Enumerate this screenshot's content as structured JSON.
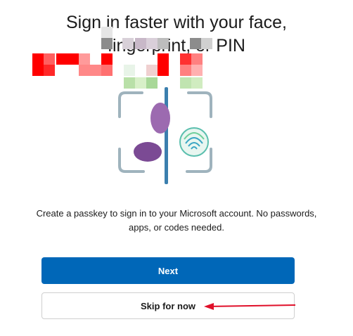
{
  "header": {
    "title_line1": "Sign in faster with your face,",
    "title_line2": "fingerprint, or PIN"
  },
  "main": {
    "description": "Create a passkey to sign in to your Microsoft account. No passwords, apps, or codes needed.",
    "illustration_icon": "passkey-face-fingerprint-icon"
  },
  "actions": {
    "next_label": "Next",
    "skip_label": "Skip for now"
  },
  "annotation": {
    "arrow_color": "#e0102a"
  },
  "colors": {
    "primary": "#0067b8",
    "text": "#1b1b1b",
    "redaction": "#ff0000"
  }
}
